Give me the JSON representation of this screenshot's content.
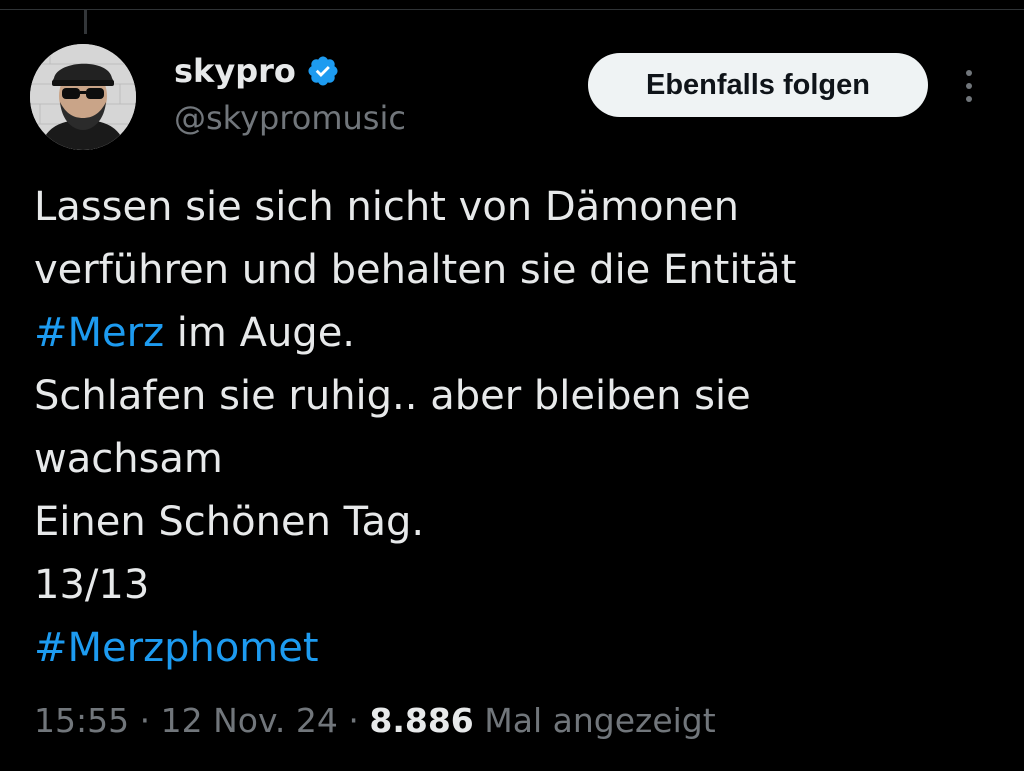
{
  "author": {
    "display_name": "skypro",
    "handle": "@skypromusic",
    "verified_color": "#1d9bf0"
  },
  "follow_button": {
    "label": "Ebenfalls folgen"
  },
  "more_menu": {
    "icon": "more-vertical-icon"
  },
  "tweet": {
    "line1": "Lassen sie sich nicht von Dämonen",
    "line2": "verführen und behalten sie die Entität",
    "line3_hashtag": "#Merz",
    "line3_rest": " im Auge.",
    "line4": "Schlafen sie ruhig.. aber bleiben sie",
    "line5": "wachsam",
    "line6": "Einen Schönen Tag.",
    "line7": "13/13",
    "line8_hashtag": "#Merzphomet"
  },
  "meta": {
    "time": "15:55",
    "separator": " · ",
    "date": "12 Nov. 24",
    "views_count": "8.886",
    "views_label": " Mal angezeigt"
  },
  "colors": {
    "background": "#000000",
    "text": "#e7e9ea",
    "secondary_text": "#71767b",
    "link": "#1d9bf0"
  }
}
